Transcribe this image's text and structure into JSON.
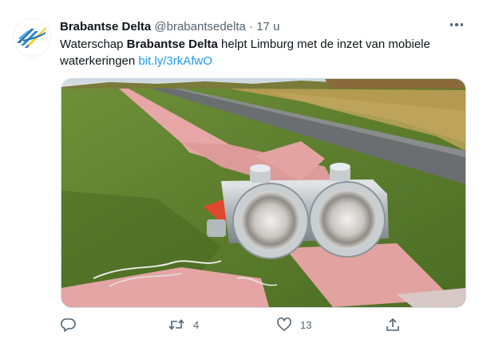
{
  "tweet": {
    "author_name": "Brabantse Delta",
    "handle": "@brabantsedelta",
    "separator": "·",
    "time": "17 u",
    "text_before": "Waterschap ",
    "text_bold": "Brabantse Delta",
    "text_after": " helpt Limburg met de inzet van mobiele waterkeringen ",
    "link": "bit.ly/3rkAfwO"
  },
  "actions": {
    "reply_count": "",
    "retweet_count": "4",
    "like_count": "13"
  },
  "icons": {
    "more": "more-horizontal-icon",
    "reply": "reply-icon",
    "retweet": "retweet-icon",
    "like": "heart-icon",
    "share": "share-icon"
  },
  "colors": {
    "link": "#1d9bf0",
    "secondary_text": "#536471",
    "logo_blue": "#1f6fb5",
    "logo_yellow": "#f2d21b"
  }
}
